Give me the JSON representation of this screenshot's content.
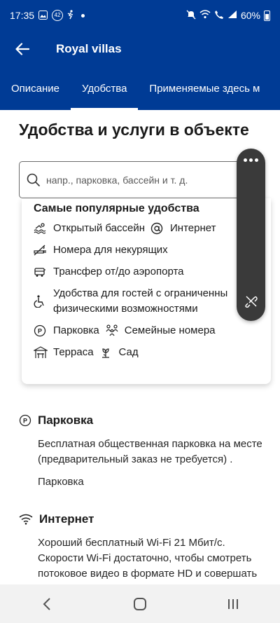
{
  "status": {
    "time": "17:35",
    "badge": "42",
    "battery": "60%"
  },
  "app_bar": {
    "title": "Royal villas"
  },
  "tabs": [
    {
      "label": "Описание"
    },
    {
      "label": "Удобства"
    },
    {
      "label": "Применяемые здесь м"
    }
  ],
  "page_title": "Удобства и услуги в объекте",
  "search": {
    "placeholder": "напр., парковка, бассейн и т. д."
  },
  "popular": {
    "title": "Самые популярные удобства",
    "items": [
      {
        "label": "Открытый бассейн",
        "icon": "pool-icon"
      },
      {
        "label": "Интернет",
        "icon": "internet-icon"
      },
      {
        "label": "Номера для некурящих",
        "icon": "no-smoking-icon"
      },
      {
        "label": "Трансфер от/до аэропорта",
        "icon": "shuttle-icon"
      },
      {
        "label": "Удобства для гостей с ограниченны",
        "label2": "физическими возможностями",
        "icon": "wheelchair-icon"
      },
      {
        "label": "Парковка",
        "icon": "parking-icon"
      },
      {
        "label": "Семейные номера",
        "icon": "family-icon"
      },
      {
        "label": "Терраса",
        "icon": "terrace-icon"
      },
      {
        "label": "Сад",
        "icon": "garden-icon"
      }
    ]
  },
  "sections": {
    "parking": {
      "title": "Парковка",
      "text1": "Бесплатная общественная парковка на месте (предварительный заказ не требуется) .",
      "text2": "Парковка"
    },
    "internet": {
      "title": "Интернет",
      "text1": "Хороший бесплатный Wi-Fi 21 Мбит/с. Скорости Wi-Fi достаточно, чтобы смотреть потоковое видео в формате HD и совершать"
    }
  },
  "colors": {
    "brand": "#003b95",
    "pill": "#3a3a3a"
  }
}
